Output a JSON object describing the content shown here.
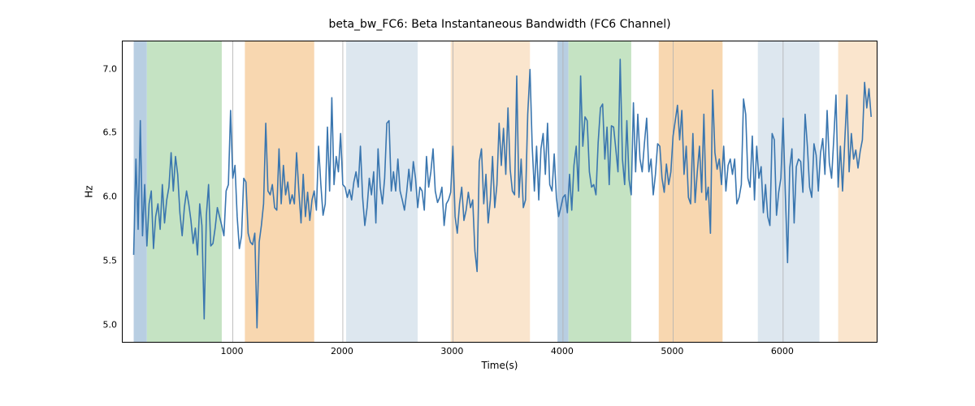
{
  "chart_data": {
    "type": "line",
    "title": "beta_bw_FC6: Beta Instantaneous Bandwidth (FC6 Channel)",
    "xlabel": "Time(s)",
    "ylabel": "Hz",
    "xlim": [
      0,
      6850
    ],
    "ylim": [
      4.87,
      7.22
    ],
    "xticks": [
      1000,
      2000,
      3000,
      4000,
      5000,
      6000
    ],
    "yticks": [
      5.0,
      5.5,
      6.0,
      6.5,
      7.0
    ],
    "bands": [
      {
        "x0": 100,
        "x1": 220,
        "color": "#b8cee2"
      },
      {
        "x0": 220,
        "x1": 900,
        "color": "#c5e3c3"
      },
      {
        "x0": 1110,
        "x1": 1740,
        "color": "#f8d7b0"
      },
      {
        "x0": 2030,
        "x1": 2680,
        "color": "#dde7ef"
      },
      {
        "x0": 2980,
        "x1": 3700,
        "color": "#fae5cd"
      },
      {
        "x0": 3950,
        "x1": 4050,
        "color": "#b8cee2"
      },
      {
        "x0": 4050,
        "x1": 4620,
        "color": "#c5e3c3"
      },
      {
        "x0": 4870,
        "x1": 5450,
        "color": "#f8d7b0"
      },
      {
        "x0": 5770,
        "x1": 6330,
        "color": "#dde7ef"
      },
      {
        "x0": 6500,
        "x1": 6850,
        "color": "#fae5cd"
      }
    ],
    "series": [
      {
        "name": "beta_bw_FC6",
        "color": "#3a76af",
        "x": [
          100,
          120,
          140,
          160,
          180,
          200,
          220,
          240,
          260,
          280,
          300,
          320,
          340,
          360,
          380,
          400,
          420,
          440,
          460,
          480,
          500,
          520,
          540,
          560,
          580,
          600,
          620,
          640,
          660,
          680,
          700,
          720,
          740,
          760,
          780,
          800,
          820,
          840,
          860,
          880,
          900,
          920,
          940,
          960,
          980,
          1000,
          1020,
          1040,
          1060,
          1080,
          1100,
          1120,
          1140,
          1160,
          1180,
          1200,
          1220,
          1240,
          1260,
          1280,
          1300,
          1320,
          1340,
          1360,
          1380,
          1400,
          1420,
          1440,
          1460,
          1480,
          1500,
          1520,
          1540,
          1560,
          1580,
          1600,
          1620,
          1640,
          1660,
          1680,
          1700,
          1720,
          1740,
          1760,
          1780,
          1800,
          1820,
          1840,
          1860,
          1880,
          1900,
          1920,
          1940,
          1960,
          1980,
          2000,
          2020,
          2040,
          2060,
          2080,
          2100,
          2120,
          2140,
          2160,
          2180,
          2200,
          2220,
          2240,
          2260,
          2280,
          2300,
          2320,
          2340,
          2360,
          2380,
          2400,
          2420,
          2440,
          2460,
          2480,
          2500,
          2520,
          2540,
          2560,
          2580,
          2600,
          2620,
          2640,
          2660,
          2680,
          2700,
          2720,
          2740,
          2760,
          2780,
          2800,
          2820,
          2840,
          2860,
          2880,
          2900,
          2920,
          2940,
          2960,
          2980,
          3000,
          3020,
          3040,
          3060,
          3080,
          3100,
          3120,
          3140,
          3160,
          3180,
          3200,
          3220,
          3240,
          3260,
          3280,
          3300,
          3320,
          3340,
          3360,
          3380,
          3400,
          3420,
          3440,
          3460,
          3480,
          3500,
          3520,
          3540,
          3560,
          3580,
          3600,
          3620,
          3640,
          3660,
          3680,
          3700,
          3720,
          3740,
          3760,
          3780,
          3800,
          3820,
          3840,
          3860,
          3880,
          3900,
          3920,
          3940,
          3960,
          3980,
          4000,
          4020,
          4040,
          4060,
          4080,
          4100,
          4120,
          4140,
          4160,
          4180,
          4200,
          4220,
          4240,
          4260,
          4280,
          4300,
          4320,
          4340,
          4360,
          4380,
          4400,
          4420,
          4440,
          4460,
          4480,
          4500,
          4520,
          4540,
          4560,
          4580,
          4600,
          4620,
          4640,
          4660,
          4680,
          4700,
          4720,
          4740,
          4760,
          4780,
          4800,
          4820,
          4840,
          4860,
          4880,
          4900,
          4920,
          4940,
          4960,
          4980,
          5000,
          5020,
          5040,
          5060,
          5080,
          5100,
          5120,
          5140,
          5160,
          5180,
          5200,
          5220,
          5240,
          5260,
          5280,
          5300,
          5320,
          5340,
          5360,
          5380,
          5400,
          5420,
          5440,
          5460,
          5480,
          5500,
          5520,
          5540,
          5560,
          5580,
          5600,
          5620,
          5640,
          5660,
          5680,
          5700,
          5720,
          5740,
          5760,
          5780,
          5800,
          5820,
          5840,
          5860,
          5880,
          5900,
          5920,
          5940,
          5960,
          5980,
          6000,
          6020,
          6040,
          6060,
          6080,
          6100,
          6120,
          6140,
          6160,
          6180,
          6200,
          6220,
          6240,
          6260,
          6280,
          6300,
          6320,
          6340,
          6360,
          6380,
          6400,
          6420,
          6440,
          6460,
          6480,
          6500,
          6520,
          6540,
          6560,
          6580,
          6600,
          6620,
          6640,
          6660,
          6680,
          6700,
          6720,
          6740,
          6760,
          6780,
          6800,
          6820,
          6840
        ],
        "y": [
          5.55,
          6.3,
          5.75,
          6.6,
          5.7,
          6.1,
          5.62,
          5.95,
          6.05,
          5.6,
          5.85,
          5.95,
          5.75,
          6.1,
          5.8,
          5.98,
          6.08,
          6.35,
          6.05,
          6.32,
          6.18,
          5.88,
          5.7,
          5.92,
          6.05,
          5.95,
          5.82,
          5.64,
          5.76,
          5.55,
          5.95,
          5.78,
          5.05,
          5.86,
          6.1,
          5.62,
          5.64,
          5.76,
          5.92,
          5.85,
          5.78,
          5.7,
          6.05,
          6.1,
          6.68,
          6.15,
          6.25,
          5.85,
          5.6,
          5.7,
          6.15,
          6.12,
          5.72,
          5.65,
          5.63,
          5.72,
          4.98,
          5.65,
          5.78,
          5.95,
          6.58,
          6.05,
          6.02,
          6.1,
          5.92,
          5.9,
          6.38,
          5.95,
          6.25,
          6.02,
          6.12,
          5.95,
          6.02,
          5.95,
          6.35,
          6.05,
          5.8,
          6.18,
          5.85,
          6.04,
          5.82,
          5.98,
          6.05,
          5.9,
          6.4,
          6.1,
          5.86,
          5.95,
          6.55,
          6.05,
          6.78,
          6.1,
          6.32,
          6.2,
          6.5,
          6.1,
          6.08,
          6.0,
          6.06,
          5.98,
          6.12,
          6.2,
          6.08,
          6.4,
          6.0,
          5.78,
          5.92,
          6.15,
          6.02,
          6.2,
          5.8,
          6.38,
          6.08,
          5.95,
          6.15,
          6.58,
          6.6,
          6.05,
          6.2,
          6.05,
          6.3,
          6.05,
          5.98,
          5.9,
          6.04,
          6.22,
          6.05,
          6.28,
          6.15,
          5.92,
          6.08,
          6.05,
          5.9,
          6.32,
          6.08,
          6.2,
          6.38,
          6.05,
          5.96,
          6.0,
          6.08,
          5.78,
          5.95,
          5.98,
          6.04,
          6.4,
          5.85,
          5.72,
          5.95,
          6.08,
          5.82,
          5.9,
          6.04,
          5.92,
          5.98,
          5.58,
          5.42,
          6.28,
          6.38,
          5.95,
          6.18,
          5.8,
          5.98,
          6.32,
          5.92,
          6.1,
          6.58,
          6.25,
          6.54,
          6.18,
          6.7,
          6.22,
          6.05,
          6.02,
          6.95,
          6.0,
          6.3,
          5.92,
          5.98,
          6.65,
          7.0,
          6.4,
          6.05,
          6.4,
          5.98,
          6.38,
          6.5,
          6.18,
          6.58,
          6.1,
          6.05,
          6.34,
          6.0,
          5.85,
          5.92,
          6.0,
          6.02,
          5.88,
          6.18,
          5.9,
          6.25,
          6.4,
          6.05,
          6.95,
          6.4,
          6.63,
          6.6,
          6.2,
          6.08,
          6.1,
          6.02,
          6.43,
          6.7,
          6.73,
          6.3,
          6.55,
          6.1,
          6.56,
          6.55,
          6.38,
          6.2,
          7.08,
          6.3,
          6.1,
          6.6,
          6.14,
          6.02,
          6.74,
          6.2,
          6.65,
          6.3,
          6.2,
          6.42,
          6.62,
          6.2,
          6.3,
          6.02,
          6.18,
          6.42,
          6.4,
          6.15,
          6.04,
          6.26,
          6.1,
          6.2,
          6.48,
          6.6,
          6.72,
          6.45,
          6.68,
          6.18,
          6.4,
          6.0,
          5.95,
          6.5,
          5.96,
          6.2,
          6.4,
          6.04,
          6.65,
          5.98,
          6.08,
          5.72,
          6.84,
          6.35,
          6.22,
          6.3,
          6.1,
          6.4,
          6.05,
          6.25,
          6.3,
          6.18,
          6.3,
          5.95,
          6.0,
          6.1,
          6.77,
          6.65,
          6.15,
          6.08,
          6.48,
          5.98,
          6.4,
          6.15,
          6.24,
          5.88,
          6.1,
          5.85,
          5.78,
          6.5,
          6.45,
          5.86,
          6.04,
          6.15,
          6.62,
          6.02,
          5.49,
          6.23,
          6.38,
          5.8,
          6.24,
          6.3,
          6.28,
          6.04,
          6.65,
          6.4,
          6.08,
          6.0,
          6.42,
          6.33,
          6.05,
          6.35,
          6.46,
          6.18,
          6.68,
          6.27,
          6.15,
          6.46,
          6.8,
          6.08,
          6.4,
          6.05,
          6.44,
          6.8,
          6.2,
          6.5,
          6.3,
          6.37,
          6.23,
          6.36,
          6.45,
          6.9,
          6.7,
          6.85,
          6.63
        ]
      }
    ]
  }
}
